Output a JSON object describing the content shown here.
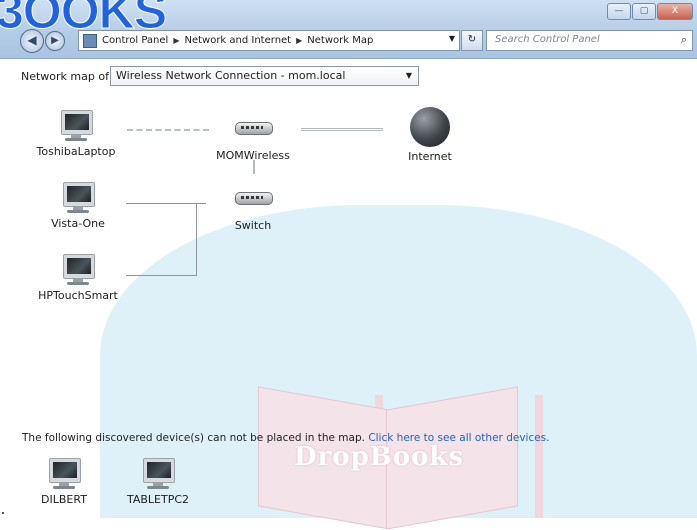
{
  "watermark": {
    "top_text": "3OOKS",
    "center_text": "DropBooks"
  },
  "window": {
    "minimize": "—",
    "maximize": "▢",
    "close": "X"
  },
  "nav": {
    "back": "◀",
    "forward": "▶",
    "breadcrumbs": [
      "Control Panel",
      "Network and Internet",
      "Network Map"
    ],
    "search_placeholder": "Search Control Panel",
    "refresh": "↻",
    "search_icon": "⌕"
  },
  "map": {
    "label": "Network map of",
    "selected_connection": "Wireless Network Connection - mom.local",
    "nodes": {
      "toshiba": "ToshibaLaptop",
      "momwireless": "MOMWireless",
      "internet": "Internet",
      "vista": "Vista-One",
      "switch": "Switch",
      "hptouch": "HPTouchSmart"
    }
  },
  "discovered": {
    "text": "The following discovered device(s) can not be placed in the map.",
    "link": "Click here to see all other devices.",
    "devices": [
      "DILBERT",
      "TABLETPC2"
    ]
  }
}
